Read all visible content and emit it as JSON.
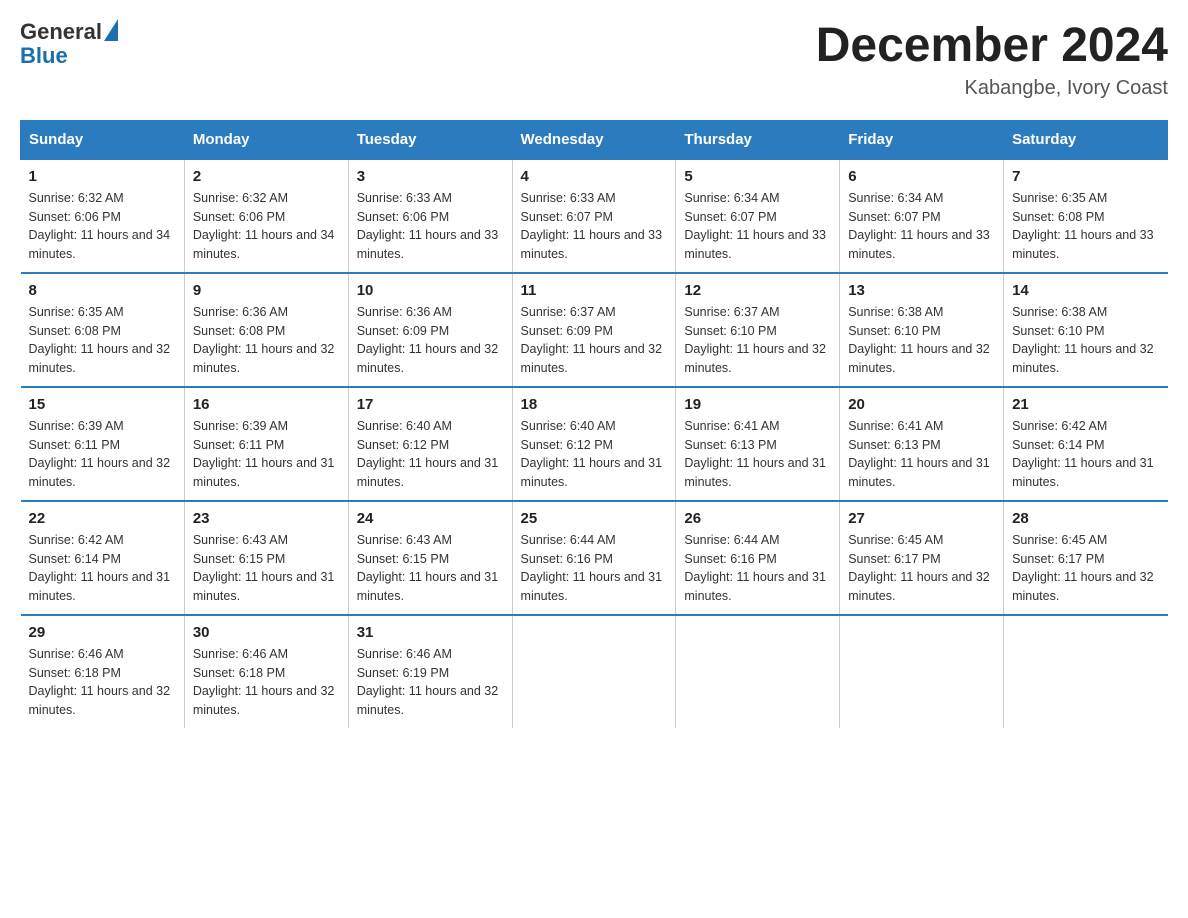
{
  "header": {
    "logo_general": "General",
    "logo_blue": "Blue",
    "month_title": "December 2024",
    "location": "Kabangbe, Ivory Coast"
  },
  "days_of_week": [
    "Sunday",
    "Monday",
    "Tuesday",
    "Wednesday",
    "Thursday",
    "Friday",
    "Saturday"
  ],
  "weeks": [
    [
      {
        "day": "1",
        "sunrise": "6:32 AM",
        "sunset": "6:06 PM",
        "daylight": "11 hours and 34 minutes."
      },
      {
        "day": "2",
        "sunrise": "6:32 AM",
        "sunset": "6:06 PM",
        "daylight": "11 hours and 34 minutes."
      },
      {
        "day": "3",
        "sunrise": "6:33 AM",
        "sunset": "6:06 PM",
        "daylight": "11 hours and 33 minutes."
      },
      {
        "day": "4",
        "sunrise": "6:33 AM",
        "sunset": "6:07 PM",
        "daylight": "11 hours and 33 minutes."
      },
      {
        "day": "5",
        "sunrise": "6:34 AM",
        "sunset": "6:07 PM",
        "daylight": "11 hours and 33 minutes."
      },
      {
        "day": "6",
        "sunrise": "6:34 AM",
        "sunset": "6:07 PM",
        "daylight": "11 hours and 33 minutes."
      },
      {
        "day": "7",
        "sunrise": "6:35 AM",
        "sunset": "6:08 PM",
        "daylight": "11 hours and 33 minutes."
      }
    ],
    [
      {
        "day": "8",
        "sunrise": "6:35 AM",
        "sunset": "6:08 PM",
        "daylight": "11 hours and 32 minutes."
      },
      {
        "day": "9",
        "sunrise": "6:36 AM",
        "sunset": "6:08 PM",
        "daylight": "11 hours and 32 minutes."
      },
      {
        "day": "10",
        "sunrise": "6:36 AM",
        "sunset": "6:09 PM",
        "daylight": "11 hours and 32 minutes."
      },
      {
        "day": "11",
        "sunrise": "6:37 AM",
        "sunset": "6:09 PM",
        "daylight": "11 hours and 32 minutes."
      },
      {
        "day": "12",
        "sunrise": "6:37 AM",
        "sunset": "6:10 PM",
        "daylight": "11 hours and 32 minutes."
      },
      {
        "day": "13",
        "sunrise": "6:38 AM",
        "sunset": "6:10 PM",
        "daylight": "11 hours and 32 minutes."
      },
      {
        "day": "14",
        "sunrise": "6:38 AM",
        "sunset": "6:10 PM",
        "daylight": "11 hours and 32 minutes."
      }
    ],
    [
      {
        "day": "15",
        "sunrise": "6:39 AM",
        "sunset": "6:11 PM",
        "daylight": "11 hours and 32 minutes."
      },
      {
        "day": "16",
        "sunrise": "6:39 AM",
        "sunset": "6:11 PM",
        "daylight": "11 hours and 31 minutes."
      },
      {
        "day": "17",
        "sunrise": "6:40 AM",
        "sunset": "6:12 PM",
        "daylight": "11 hours and 31 minutes."
      },
      {
        "day": "18",
        "sunrise": "6:40 AM",
        "sunset": "6:12 PM",
        "daylight": "11 hours and 31 minutes."
      },
      {
        "day": "19",
        "sunrise": "6:41 AM",
        "sunset": "6:13 PM",
        "daylight": "11 hours and 31 minutes."
      },
      {
        "day": "20",
        "sunrise": "6:41 AM",
        "sunset": "6:13 PM",
        "daylight": "11 hours and 31 minutes."
      },
      {
        "day": "21",
        "sunrise": "6:42 AM",
        "sunset": "6:14 PM",
        "daylight": "11 hours and 31 minutes."
      }
    ],
    [
      {
        "day": "22",
        "sunrise": "6:42 AM",
        "sunset": "6:14 PM",
        "daylight": "11 hours and 31 minutes."
      },
      {
        "day": "23",
        "sunrise": "6:43 AM",
        "sunset": "6:15 PM",
        "daylight": "11 hours and 31 minutes."
      },
      {
        "day": "24",
        "sunrise": "6:43 AM",
        "sunset": "6:15 PM",
        "daylight": "11 hours and 31 minutes."
      },
      {
        "day": "25",
        "sunrise": "6:44 AM",
        "sunset": "6:16 PM",
        "daylight": "11 hours and 31 minutes."
      },
      {
        "day": "26",
        "sunrise": "6:44 AM",
        "sunset": "6:16 PM",
        "daylight": "11 hours and 31 minutes."
      },
      {
        "day": "27",
        "sunrise": "6:45 AM",
        "sunset": "6:17 PM",
        "daylight": "11 hours and 32 minutes."
      },
      {
        "day": "28",
        "sunrise": "6:45 AM",
        "sunset": "6:17 PM",
        "daylight": "11 hours and 32 minutes."
      }
    ],
    [
      {
        "day": "29",
        "sunrise": "6:46 AM",
        "sunset": "6:18 PM",
        "daylight": "11 hours and 32 minutes."
      },
      {
        "day": "30",
        "sunrise": "6:46 AM",
        "sunset": "6:18 PM",
        "daylight": "11 hours and 32 minutes."
      },
      {
        "day": "31",
        "sunrise": "6:46 AM",
        "sunset": "6:19 PM",
        "daylight": "11 hours and 32 minutes."
      },
      null,
      null,
      null,
      null
    ]
  ]
}
